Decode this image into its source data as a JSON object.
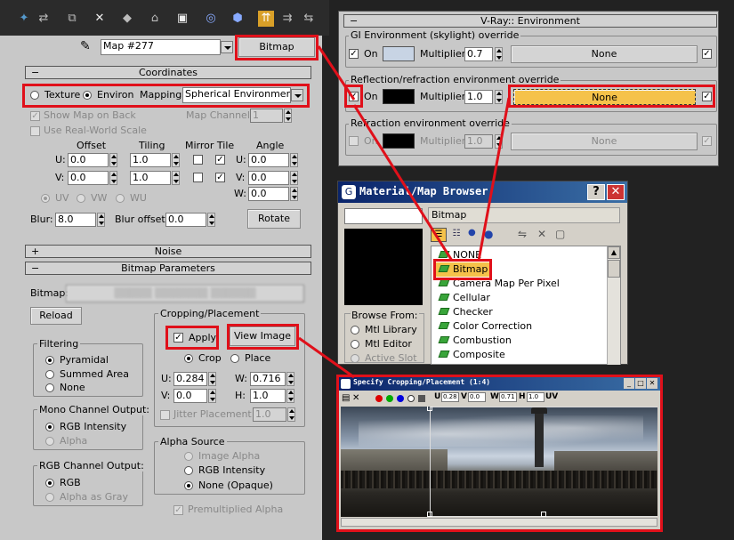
{
  "toolbar": {
    "icons": [
      "pick-material-icon",
      "put-material-icon",
      "assign-material-icon",
      "reset-map-icon",
      "make-unique-icon",
      "put-library-icon",
      "material-id-icon",
      "show-map-icon",
      "show-end-result-icon",
      "go-parent-icon",
      "go-sibling-icon"
    ]
  },
  "map_header": {
    "map_name": "Map #277",
    "map_type_button": "Bitmap"
  },
  "coordinates": {
    "title": "Coordinates",
    "texture_label": "Texture",
    "environ_label": "Environ",
    "mapping_label": "Mapping:",
    "mapping_value": "Spherical Environment",
    "show_map_on_back": "Show Map on Back",
    "map_channel_label": "Map Channel:",
    "map_channel_value": "1",
    "use_real_world_scale": "Use Real-World Scale",
    "offset_header": "Offset",
    "tiling_header": "Tiling",
    "mirror_tile_header": "Mirror Tile",
    "angle_header": "Angle",
    "u_label": "U:",
    "v_label": "V:",
    "w_label": "W:",
    "offset_u": "0.0",
    "offset_v": "0.0",
    "tiling_u": "1.0",
    "tiling_v": "1.0",
    "angle_u": "0.0",
    "angle_v": "0.0",
    "angle_w": "0.0",
    "uv_label": "UV",
    "vw_label": "VW",
    "wu_label": "WU",
    "blur_label": "Blur:",
    "blur_value": "8.0",
    "blur_offset_label": "Blur offset:",
    "blur_offset_value": "0.0",
    "rotate_button": "Rotate"
  },
  "noise": {
    "title": "Noise"
  },
  "bitmap_params": {
    "title": "Bitmap Parameters",
    "bitmap_label": "Bitmap:",
    "reload_button": "Reload",
    "cropping_title": "Cropping/Placement",
    "apply_label": "Apply",
    "view_image_button": "View Image",
    "crop_label": "Crop",
    "place_label": "Place",
    "u_label": "U:",
    "u_value": "0.284",
    "w_label": "W:",
    "w_value": "0.716",
    "v_label": "V:",
    "v_value": "0.0",
    "h_label": "H:",
    "h_value": "1.0",
    "jitter_label": "Jitter Placement:",
    "jitter_value": "1.0",
    "filtering_title": "Filtering",
    "pyramidal": "Pyramidal",
    "summed_area": "Summed Area",
    "none": "None",
    "mono_title": "Mono Channel Output:",
    "rgb_intensity": "RGB Intensity",
    "alpha": "Alpha",
    "rgb_channel_title": "RGB Channel Output:",
    "rgb": "RGB",
    "alpha_as_gray": "Alpha as Gray",
    "alpha_source_title": "Alpha Source",
    "image_alpha": "Image Alpha",
    "rgb_intensity_2": "RGB Intensity",
    "none_opaque": "None (Opaque)",
    "premultiplied_alpha": "Premultiplied Alpha"
  },
  "vray_env": {
    "title": "V-Ray:: Environment",
    "gi_title": "GI Environment (skylight) override",
    "refl_title": "Reflection/refraction environment override",
    "refr_title": "Refraction environment override",
    "on_label": "On",
    "multiplier_label": "Multiplier:",
    "gi_mult": "0.7",
    "gi_map": "None",
    "refl_mult": "1.0",
    "refl_map": "None",
    "refr_mult": "1.0",
    "refr_map": "None"
  },
  "browser": {
    "title": "Material/Map Browser",
    "category": "Bitmap",
    "browse_from": "Browse From:",
    "mtl_library": "Mtl Library",
    "mtl_editor": "Mtl Editor",
    "active_slot": "Active Slot",
    "items": [
      "NONE",
      "Bitmap",
      "Camera Map Per Pixel",
      "Cellular",
      "Checker",
      "Color Correction",
      "Combustion",
      "Composite"
    ]
  },
  "crop_window": {
    "title": "Specify Cropping/Placement (1:4)",
    "u_label": "U",
    "u_value": "0.28",
    "v_label": "V",
    "v_value": "0.0",
    "w_label": "W",
    "w_value": "0.71",
    "h_label": "H",
    "h_value": "1.0",
    "uv_label": "UV"
  },
  "colors": {
    "panel": "#c8c8c8",
    "highlight": "#e0101a",
    "titlebar": "#0a246a",
    "selected": "#f5c24a"
  }
}
